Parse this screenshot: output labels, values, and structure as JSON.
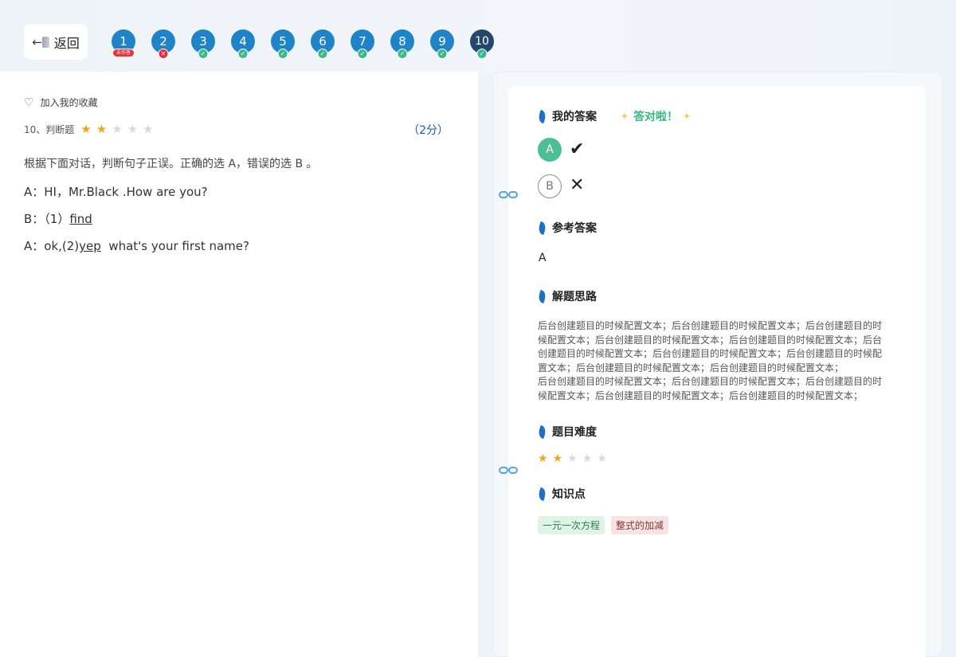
{
  "header": {
    "back_label": "返回",
    "back_icon": "logout-arrow-icon",
    "questions": [
      {
        "num": "1",
        "status": "unanswered",
        "badge": "未作答"
      },
      {
        "num": "2",
        "status": "wrong",
        "badge": "✕"
      },
      {
        "num": "3",
        "status": "correct",
        "badge": "✓"
      },
      {
        "num": "4",
        "status": "correct",
        "badge": "✓"
      },
      {
        "num": "5",
        "status": "correct",
        "badge": "✓"
      },
      {
        "num": "6",
        "status": "correct",
        "badge": "✓"
      },
      {
        "num": "7",
        "status": "correct",
        "badge": "✓"
      },
      {
        "num": "8",
        "status": "correct",
        "badge": "✓"
      },
      {
        "num": "9",
        "status": "correct",
        "badge": "✓"
      },
      {
        "num": "10",
        "status": "current",
        "badge": "✓"
      }
    ]
  },
  "question": {
    "favorite_label": "加入我的收藏",
    "type_label": "10、判断题",
    "difficulty": 2,
    "difficulty_max": 5,
    "score": "（2分）",
    "text": "根据下面对话，判断句子正误。正确的选 A，错误的选 B 。",
    "dialog": {
      "line1": "A：HI，Mr.Black .How are  you?",
      "line2_prefix": "B：（1）",
      "line2_blank": "find",
      "line3_prefix": "A：ok,(2)",
      "line3_blank": "yep",
      "line3_suffix": "  what's your first name?"
    }
  },
  "answer_panel": {
    "my_answer_title": "我的答案",
    "correct_message": "答对啦！",
    "options": [
      {
        "label": "A",
        "selected": true,
        "result_icon": "✔"
      },
      {
        "label": "B",
        "selected": false,
        "result_icon": "✕"
      }
    ],
    "reference_title": "参考答案",
    "reference_answer": "A",
    "analysis_title": "解题思路",
    "analysis_text": "后台创建题目的时候配置文本；后台创建题目的时候配置文本；后台创建题目的时\n候配置文本；后台创建题目的时候配置文本；后台创建题目的时候配置文本；后台\n创建题目的时候配置文本；后台创建题目的时候配置文本；后台创建题目的时候配\n置文本；后台创建题目的时候配置文本；后台创建题目的时候配置文本；\n后台创建题目的时候配置文本；后台创建题目的时候配置文本；后台创建题目的时\n候配置文本；后台创建题目的时候配置文本；后台创建题目的时候配置文本；",
    "difficulty_title": "题目难度",
    "difficulty": 2,
    "knowledge_title": "知识点",
    "tags": [
      "一元一次方程",
      "整式的加减"
    ]
  },
  "colors": {
    "accent_blue": "#1f84c7",
    "current_dark": "#24486b",
    "correct_green": "#3cb88a",
    "wrong_red": "#e8303a",
    "star_orange": "#f5a21e"
  }
}
